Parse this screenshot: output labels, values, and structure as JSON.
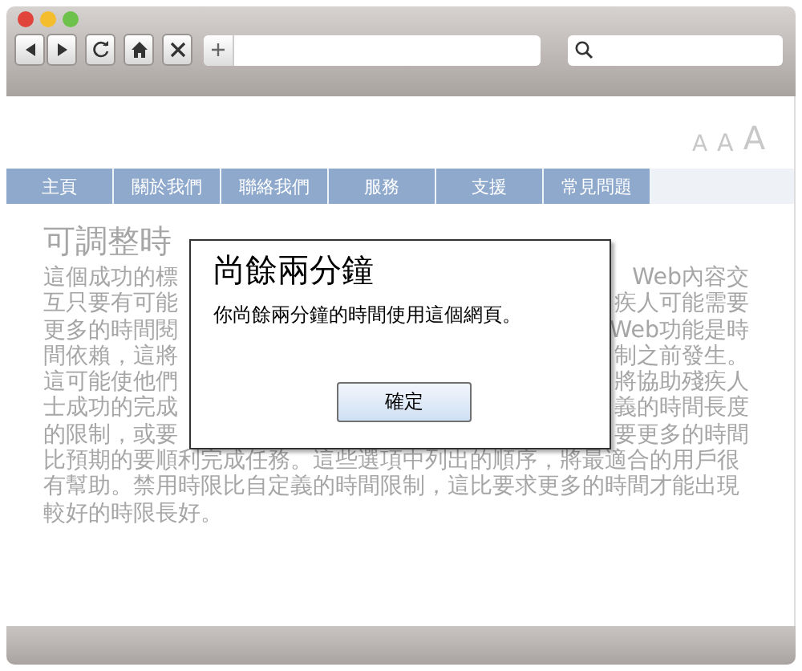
{
  "text_size": [
    {
      "label": "A",
      "kind": "small"
    },
    {
      "label": "A",
      "kind": "medium"
    },
    {
      "label": "A",
      "kind": "large"
    }
  ],
  "nav": [
    "主頁",
    "關於我們",
    "聯絡我們",
    "服務",
    "支援",
    "常見問題"
  ],
  "article": {
    "heading": "可調整時",
    "lines": [
      {
        "left": "這個成功的標",
        "right": "Web內容交"
      },
      {
        "left": "互只要有可能",
        "right": "疾人可能需要"
      },
      {
        "left": "更多的時間閱",
        "right": "Web功能是時"
      },
      {
        "left": "間依賴，這將",
        "right": "制之前發生。"
      },
      {
        "left": "這可能使他們",
        "right": "將協助殘疾人"
      },
      {
        "left": "士成功的完成",
        "right": "義的時間長度"
      },
      {
        "left": "的限制，或要",
        "right": "要更多的時間"
      },
      {
        "left": "比預期的要順利完成任務。這些選項中列出的順序，將最適合的用戶很"
      },
      {
        "left": "有幫助。禁用時限比自定義的時間限制，這比要求更多的時間才能出現"
      },
      {
        "left": "較好的時限長好。"
      }
    ]
  },
  "dialog": {
    "title": "尚餘兩分鐘",
    "message": "你尚餘兩分鐘的時間使用這個網頁。",
    "button": "確定"
  }
}
